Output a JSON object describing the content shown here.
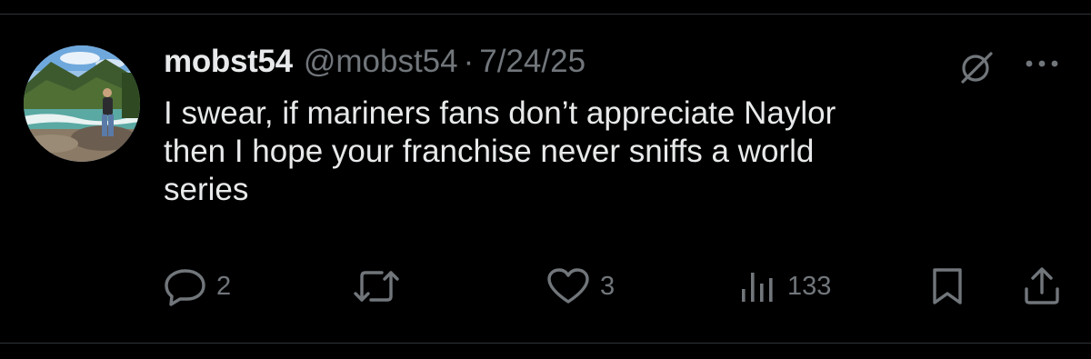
{
  "post": {
    "display_name": "mobst54",
    "handle": "@mobst54",
    "separator": "·",
    "date": "7/24/25",
    "text": "I swear, if mariners fans don’t appreciate Naylor\nthen I hope your franchise never sniffs a world\nseries"
  },
  "actions": {
    "reply_count": "2",
    "repost_count": "",
    "like_count": "3",
    "views_count": "133"
  },
  "icons": {
    "header": [
      "grok-icon",
      "more-icon"
    ],
    "actions": [
      "reply-icon",
      "repost-icon",
      "like-icon",
      "views-icon",
      "bookmark-icon",
      "share-icon"
    ]
  },
  "colors": {
    "background": "#000000",
    "text_primary": "#e7e9ea",
    "text_secondary": "#71767b",
    "divider": "#2f3336"
  }
}
